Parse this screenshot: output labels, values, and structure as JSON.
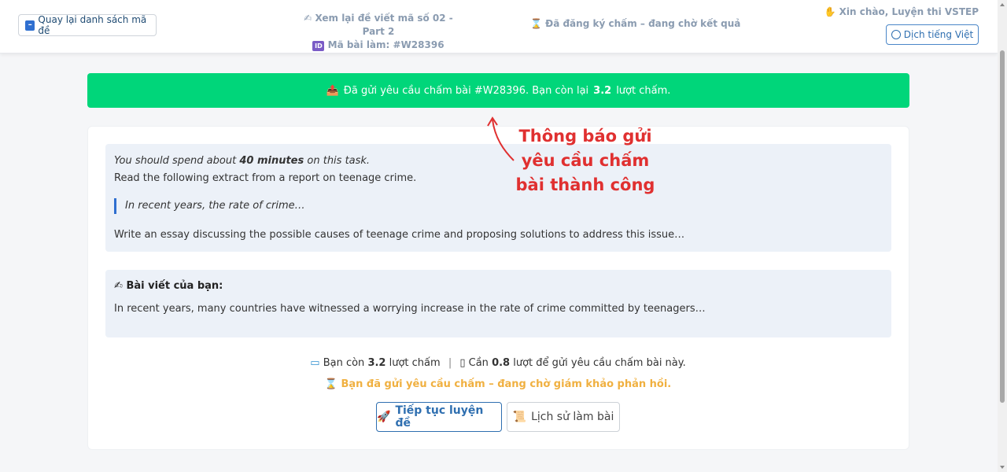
{
  "header": {
    "back_button": "Quay lại danh sách mã đề",
    "review_title": "Xem lại đề viết mã số 02 - Part 2",
    "submission_id": "Mã bài làm: #W28396",
    "status": "Đã đăng ký chấm – đang chờ kết quả",
    "greeting": "Xin chào, Luyện thi VSTEP",
    "translate_button": "Dịch tiếng Việt",
    "icons": [
      "back-square-icon",
      "writing-hand-icon",
      "id-badge-icon",
      "hourglass-icon",
      "waving-hand-icon",
      "globe-icon"
    ]
  },
  "banner": {
    "prefix": "Đã gửi yêu cầu chấm bài #W28396. Bạn còn lại",
    "remaining": "3.2",
    "suffix": "lượt chấm.",
    "color": "#00d67a",
    "icon": "outbox-tray-icon"
  },
  "task": {
    "line1_prefix": "You should spend about",
    "line1_bold": "40 minutes",
    "line1_suffix": "on this task.",
    "line2": "Read the following extract from a report on teenage crime.",
    "quote": "In recent years, the rate of crime…",
    "line3": "Write an essay discussing the possible causes of teenage crime and proposing solutions to address this issue…"
  },
  "essay": {
    "heading": "Bài viết của bạn:",
    "body": "In recent years, many countries have witnessed a worrying increase in the rate of crime committed by teenagers…",
    "icon": "writing-hand-icon"
  },
  "quota": {
    "left_prefix": "Bạn còn",
    "left_value": "3.2",
    "left_suffix": "lượt chấm",
    "separator": "|",
    "right_prefix": "Cần",
    "right_value": "0.8",
    "right_suffix": "lượt để gửi yêu cầu chấm bài này.",
    "pending": "Bạn đã gửi yêu cầu chấm – đang chờ giám khảo phản hồi.",
    "pending_color": "#f0b040"
  },
  "actions": {
    "continue": "Tiếp tục luyện đề",
    "history": "Lịch sử làm bài"
  },
  "annotation": {
    "line1": "Thông báo gửi",
    "line2": "yêu cầu chấm",
    "line3": "bài thành công",
    "color": "#e03030"
  }
}
